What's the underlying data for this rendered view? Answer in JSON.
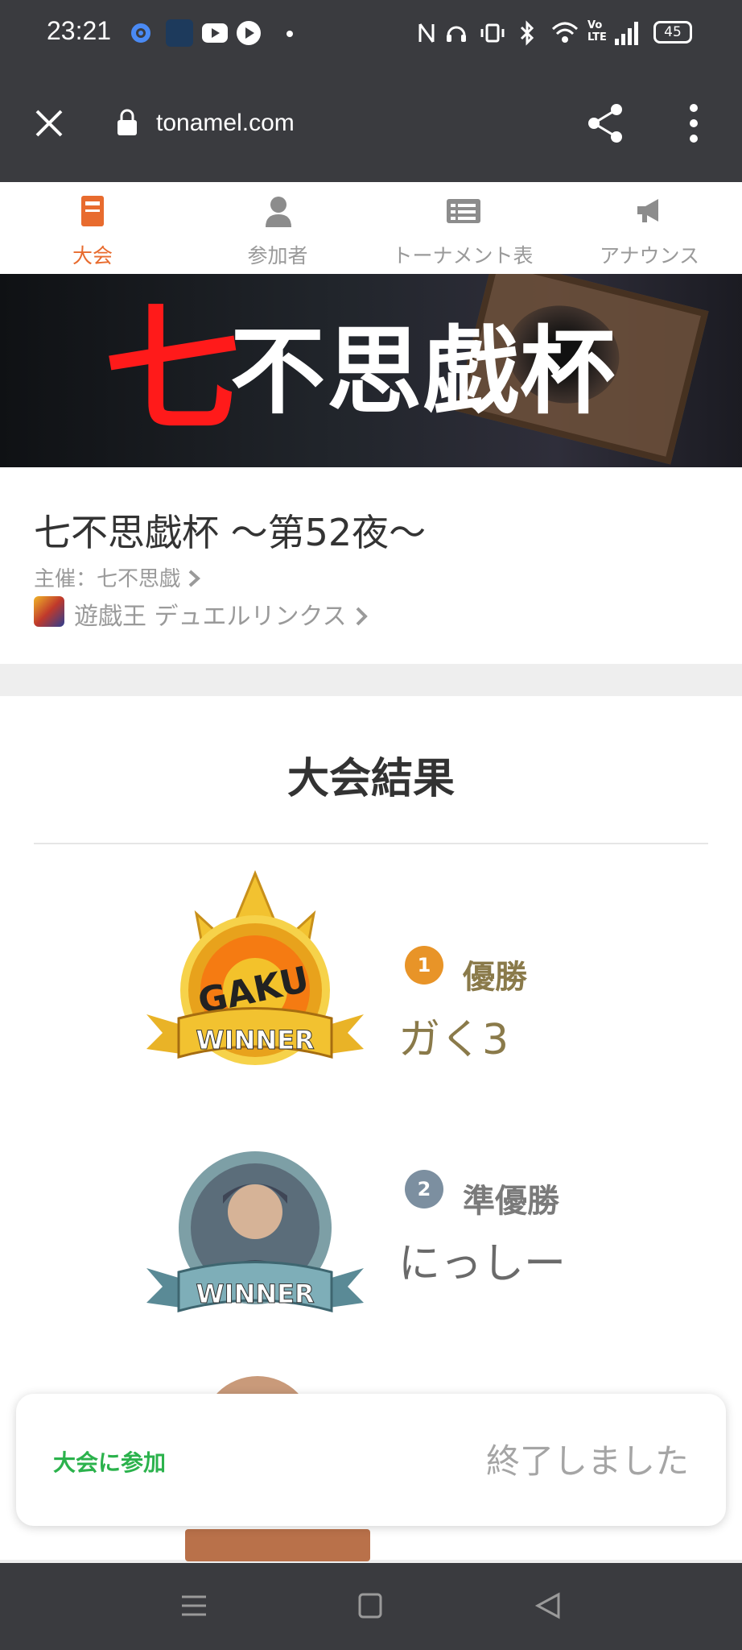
{
  "status_bar": {
    "time": "23:21",
    "left_icons": [
      "gear-icon",
      "hatena-app-icon",
      "youtube-icon",
      "play-icon",
      "dot-icon"
    ],
    "right_icons": [
      "nfc-icon",
      "headset-icon",
      "vibrate-icon",
      "bluetooth-icon",
      "wifi-icon",
      "volte-icon",
      "signal-icon"
    ],
    "battery": "45"
  },
  "browser": {
    "url": "tonamel.com"
  },
  "tabs": [
    {
      "label": "大会",
      "icon": "tournament-doc-icon",
      "active": true
    },
    {
      "label": "参加者",
      "icon": "person-icon",
      "active": false
    },
    {
      "label": "トーナメント表",
      "icon": "bracket-list-icon",
      "active": false
    },
    {
      "label": "アナウンス",
      "icon": "megaphone-icon",
      "active": false
    }
  ],
  "banner": {
    "red_char": "七",
    "white_text": "不思戯杯"
  },
  "event": {
    "title": "七不思戯杯 〜第52夜〜",
    "organizer": "主催：七不思戯",
    "game": "遊戯王 デュエルリンクス"
  },
  "results": {
    "heading": "大会結果",
    "winner_ribbon": "WINNER",
    "gaku_label": "GAKU",
    "entries": [
      {
        "place": "優勝",
        "medal": "1",
        "name": "ガく3"
      },
      {
        "place": "準優勝",
        "medal": "2",
        "name": "にっしー"
      }
    ]
  },
  "bottom_sheet": {
    "join_label": "大会に参加",
    "status": "終了しました"
  },
  "colors": {
    "accent": "#e86b2e",
    "gold_text": "#8a7a4a",
    "silver_text": "#7a7a7a",
    "join_green": "#2bb24c",
    "banner_red": "#ff1a1a"
  }
}
